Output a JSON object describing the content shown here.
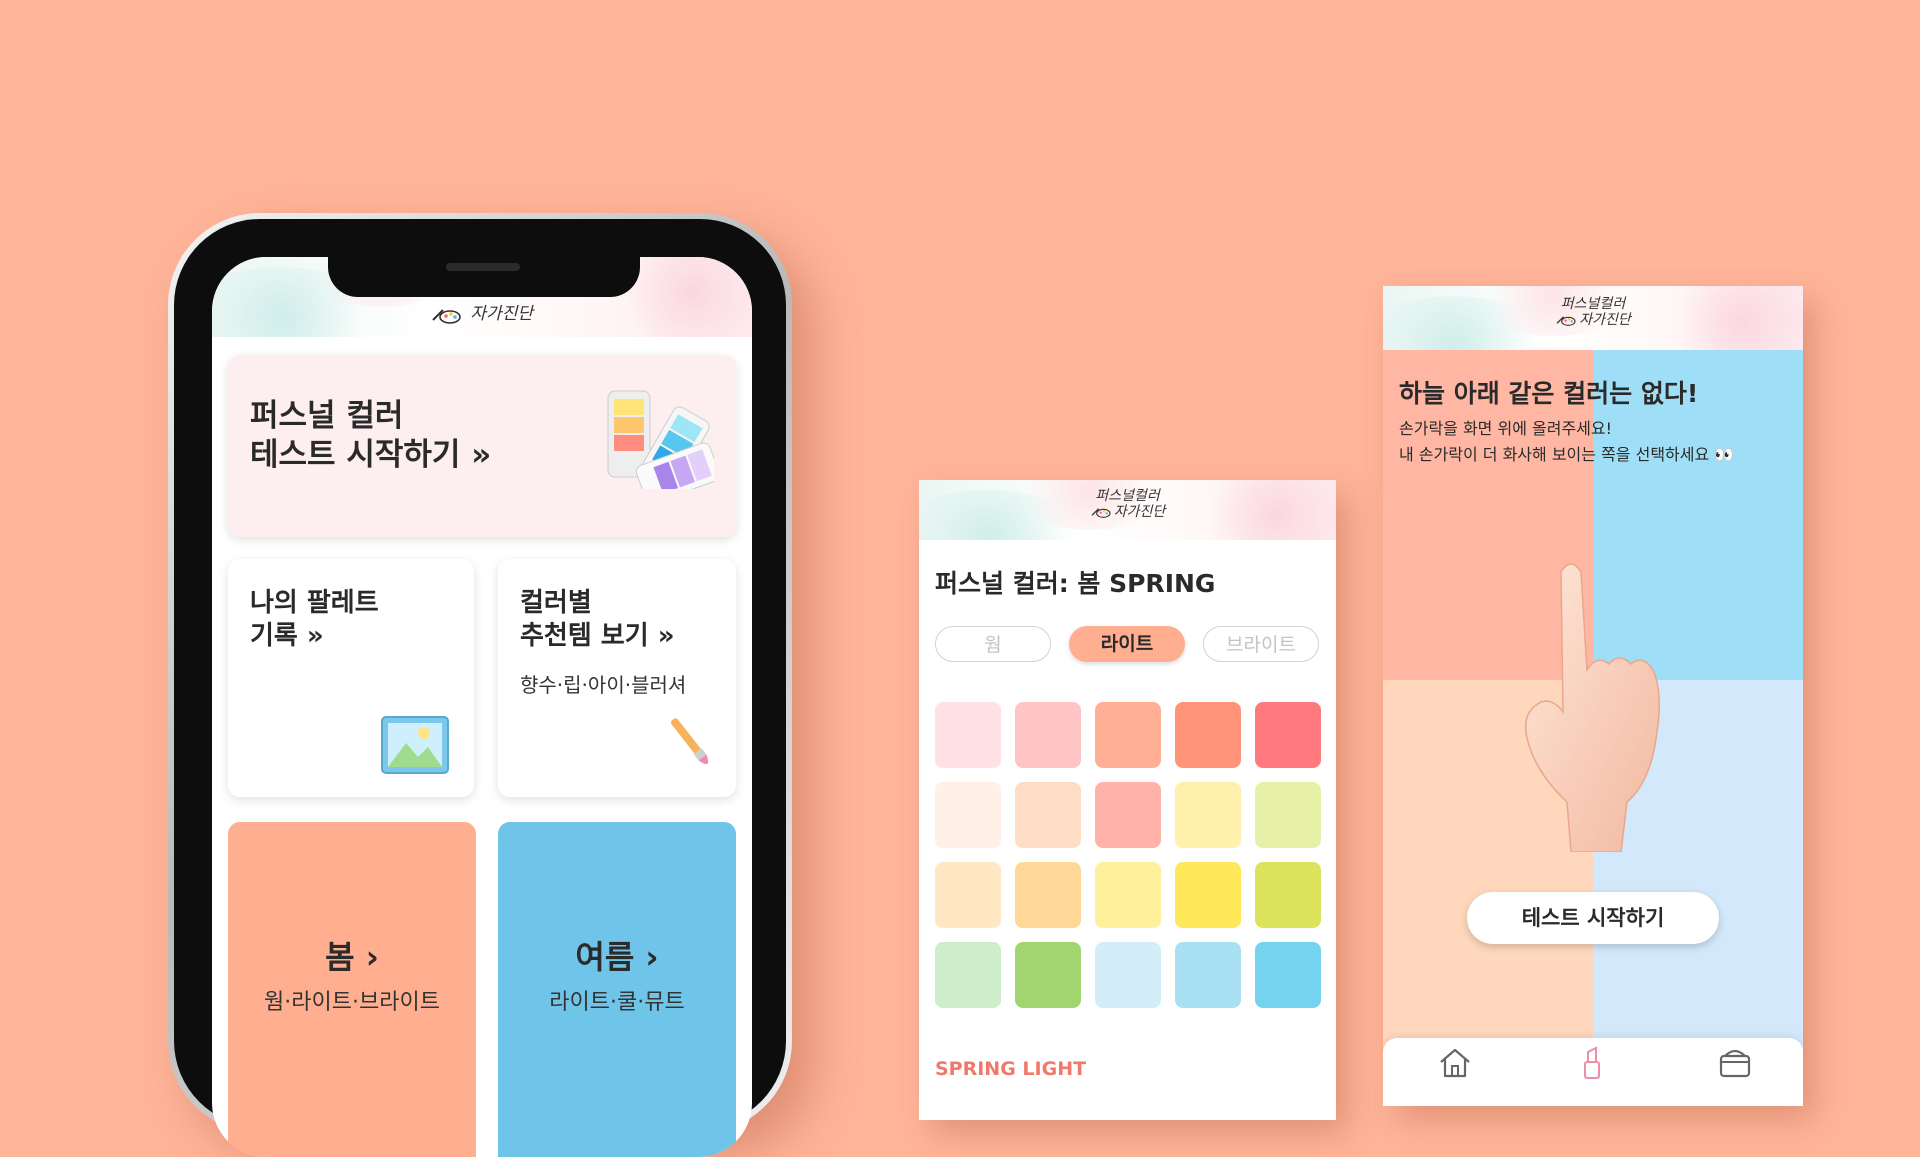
{
  "brand": {
    "logo_top": "퍼스널컬러",
    "logo_bottom": "자가진단"
  },
  "colors": {
    "background": "#FFB59A",
    "accent_peach": "#FFAE90",
    "accent_blue": "#6EC4E9",
    "accent_red_text": "#F07A6A"
  },
  "phone": {
    "hero": {
      "line1": "퍼스널 컬러",
      "line2": "테스트 시작하기 »",
      "icon": "color-palette-icon"
    },
    "palette_record": {
      "line1": "나의 팔레트",
      "line2": "기록 »",
      "icon": "picture-frame-icon"
    },
    "recommend": {
      "line1": "컬러별",
      "line2": "추천템 보기 »",
      "sub": "향수·립·아이·블러셔",
      "icon": "paintbrush-icon"
    },
    "seasons": [
      {
        "name": "봄 ›",
        "sub": "웜·라이트·브라이트"
      },
      {
        "name": "여름 ›",
        "sub": "라이트·쿨·뮤트"
      }
    ]
  },
  "spring_screen": {
    "title": "퍼스널 컬러: 봄 SPRING",
    "tabs": [
      {
        "label": "웜",
        "active": false
      },
      {
        "label": "라이트",
        "active": true
      },
      {
        "label": "브라이트",
        "active": false
      }
    ],
    "swatches": [
      "#FFE1E4",
      "#FFC5C5",
      "#FFB094",
      "#FF9479",
      "#FF7A7E",
      "#FFF1E7",
      "#FFDCC4",
      "#FFB3A8",
      "#FFF0AC",
      "#E6F0A6",
      "#FFE7C4",
      "#FFD796",
      "#FFF09C",
      "#FFE95A",
      "#DBE35C",
      "#CDEDCB",
      "#A2D570",
      "#D3EEF9",
      "#A9E0F4",
      "#76D3EF"
    ],
    "footer_label": "SPRING LIGHT"
  },
  "test_screen": {
    "headline": "하늘 아래 같은 컬러는 없다!",
    "desc_line1": "손가락을 화면 위에 올려주세요!",
    "desc_line2": "내 손가락이 더 화사해 보이는 쪽을 선택하세요 👀",
    "start_button": "테스트 시작하기",
    "tabbar": [
      "home-icon",
      "lipstick-icon",
      "cosmetic-box-icon"
    ]
  }
}
